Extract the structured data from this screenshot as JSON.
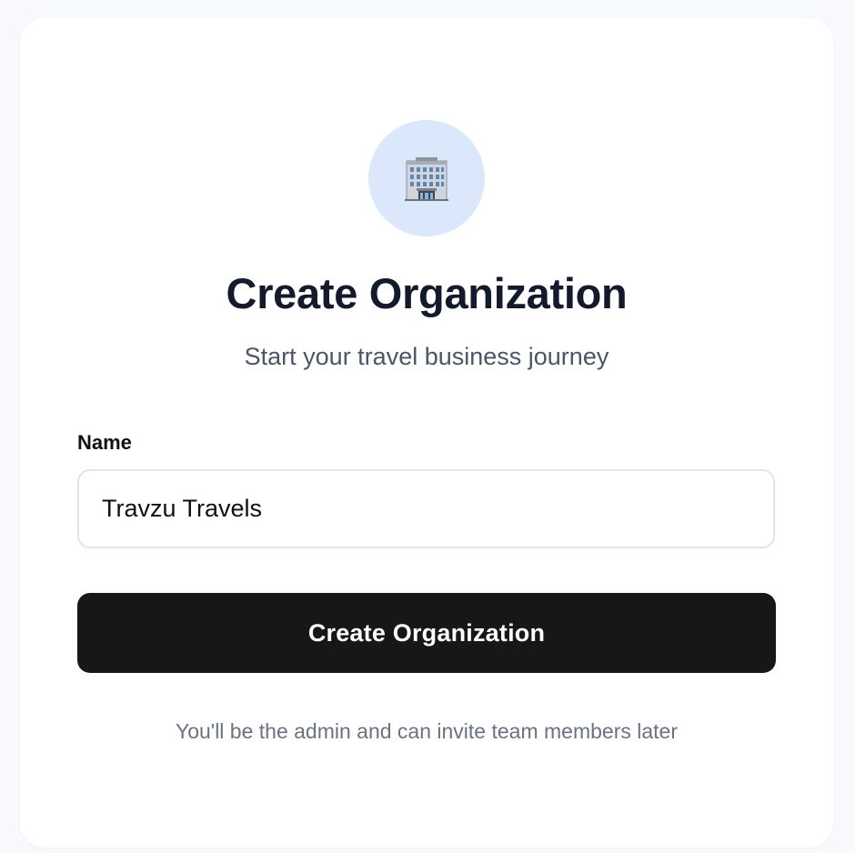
{
  "header": {
    "icon": "office-building-icon",
    "title": "Create Organization",
    "subtitle": "Start your travel business journey"
  },
  "form": {
    "name_label": "Name",
    "name_value": "Travzu Travels",
    "submit_label": "Create Organization"
  },
  "footer": {
    "note": "You'll be the admin and can invite team members later"
  },
  "colors": {
    "page_background": "#f7f9fc",
    "card_background": "#ffffff",
    "icon_circle": "#dbe8fb",
    "title_text": "#131a2b",
    "subtitle_text": "#4a5568",
    "button_background": "#171717",
    "button_text": "#ffffff",
    "footnote_text": "#6b7280"
  }
}
